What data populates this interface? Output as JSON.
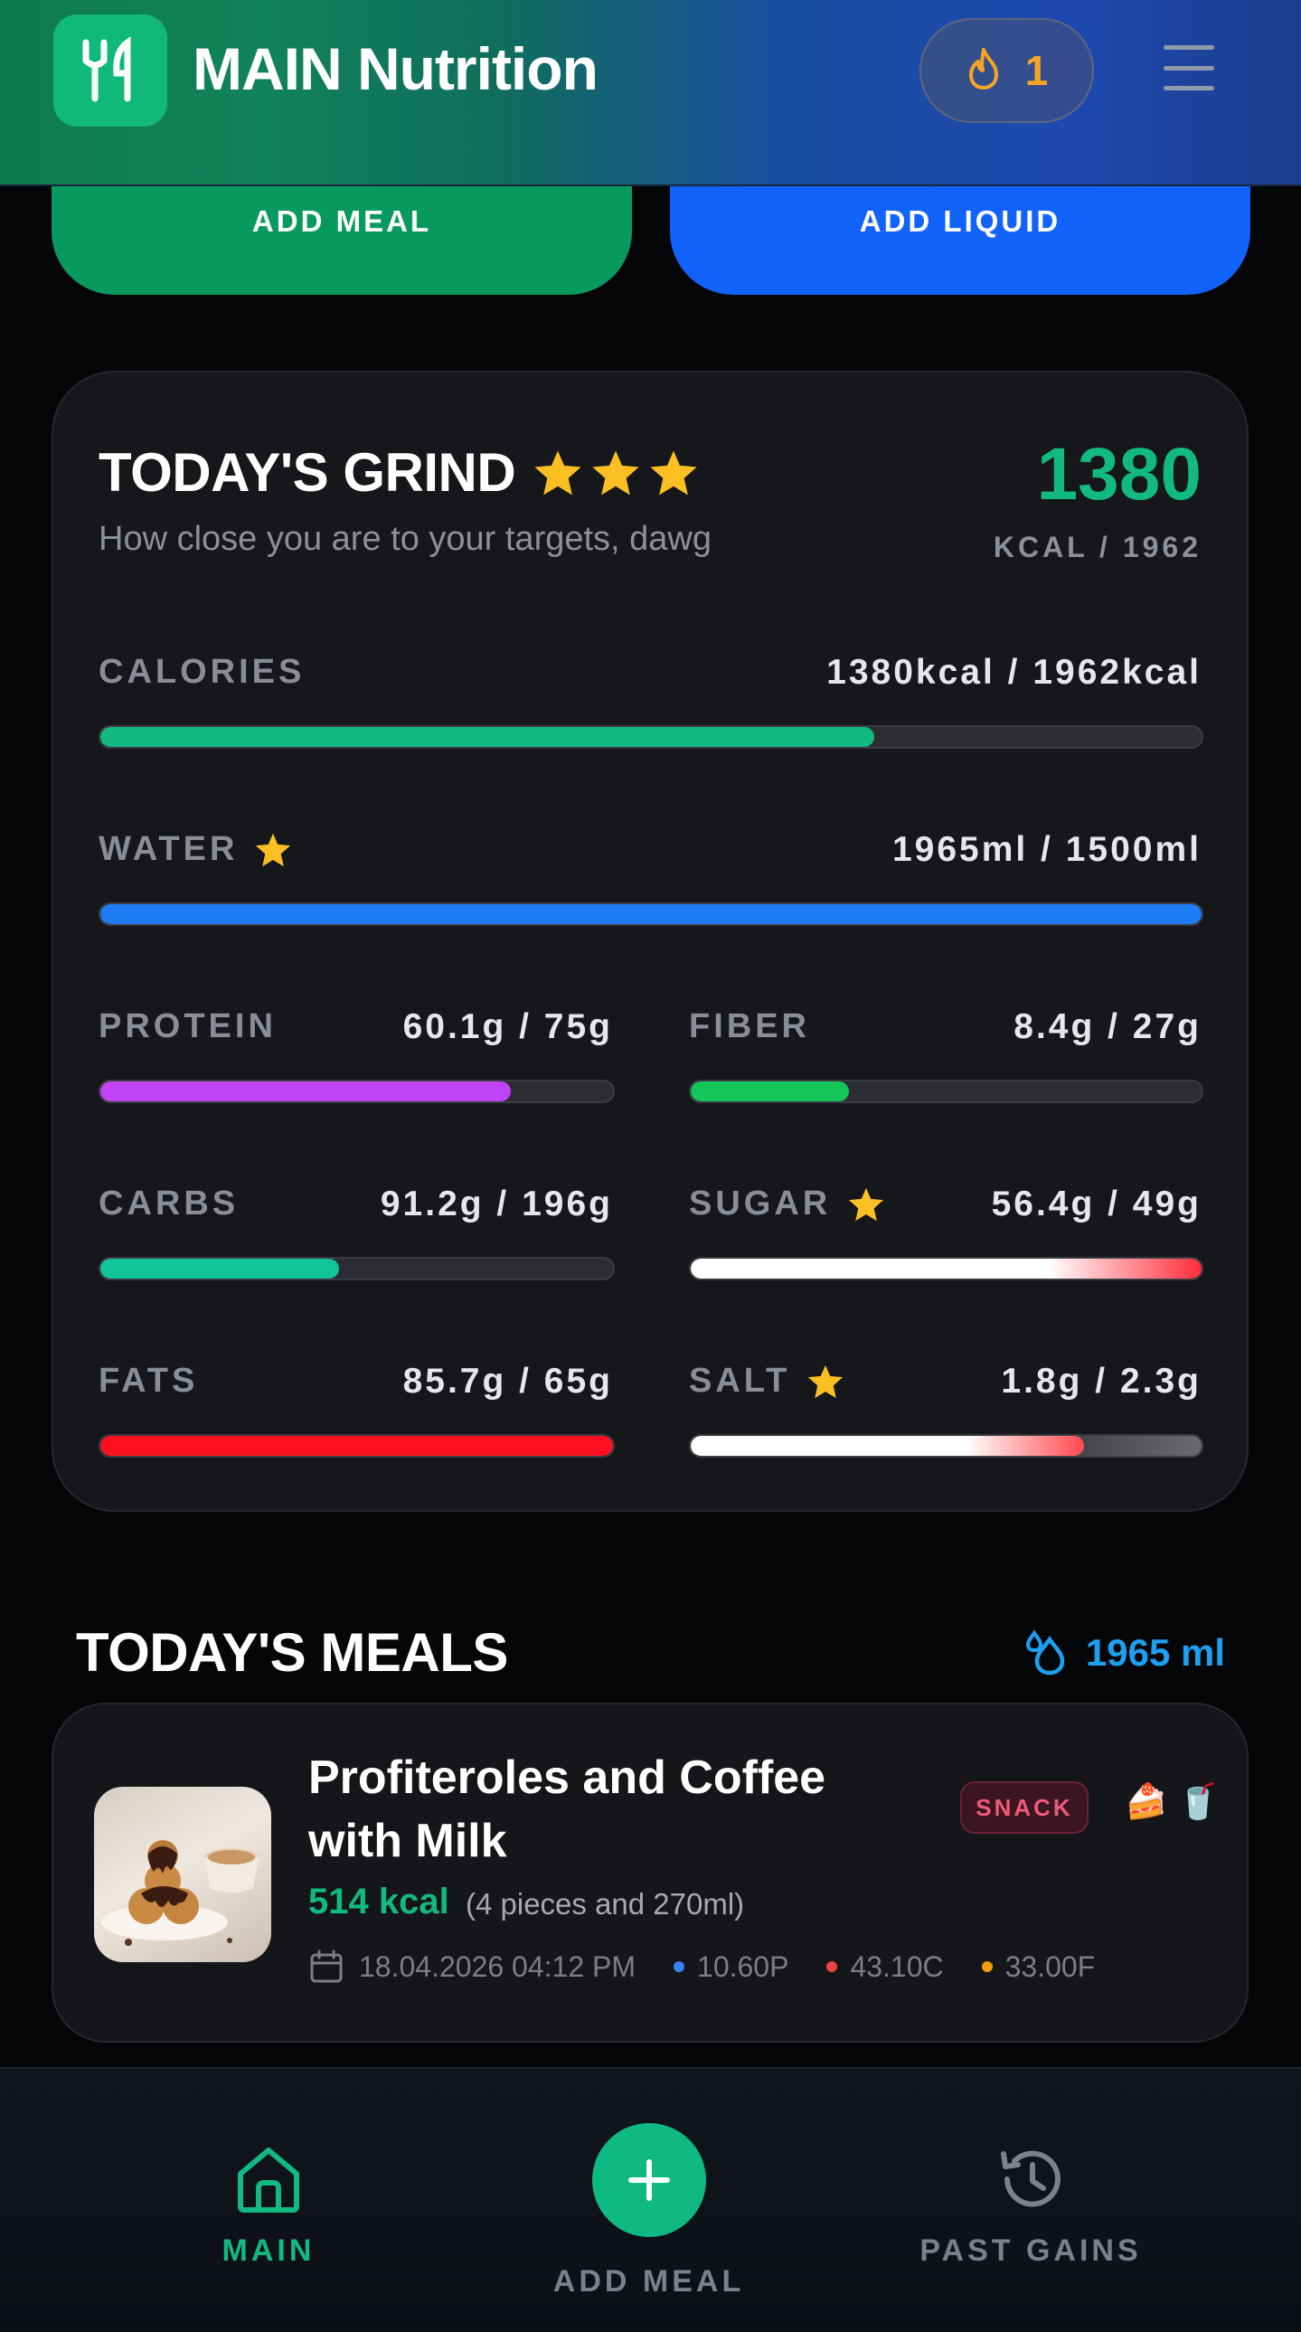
{
  "header": {
    "app_title": "MAIN Nutrition",
    "streak_count": "1",
    "logo_icon": "fork-knife-icon",
    "streak_icon": "flame-icon",
    "menu_icon": "hamburger-menu-icon"
  },
  "actions": {
    "add_meal_label": "ADD MEAL",
    "add_liquid_label": "ADD LIQUID"
  },
  "grind": {
    "title": "TODAY'S GRIND",
    "stars": 3,
    "subtitle": "How close you are to your targets, dawg",
    "kcal_value": "1380",
    "kcal_target": "KCAL / 1962",
    "metrics": {
      "calories": {
        "label": "CALORIES",
        "value": "1380kcal / 1962kcal",
        "progress": 0.703,
        "color": "#12b981"
      },
      "water": {
        "label": "WATER",
        "value": "1965ml / 1500ml",
        "progress": 1.0,
        "color": "#1e7cf5",
        "star": true
      },
      "protein": {
        "label": "PROTEIN",
        "value": "60.1g / 75g",
        "progress": 0.8,
        "color": "#c043f5"
      },
      "fiber": {
        "label": "FIBER",
        "value": "8.4g / 27g",
        "progress": 0.31,
        "color": "#14c559"
      },
      "carbs": {
        "label": "CARBS",
        "value": "91.2g / 196g",
        "progress": 0.465,
        "color": "#12c49a"
      },
      "sugar": {
        "label": "SUGAR",
        "value": "56.4g / 49g",
        "progress": 1.0,
        "color": "#ff2d3a",
        "star": true
      },
      "fats": {
        "label": "FATS",
        "value": "85.7g / 65g",
        "progress": 1.0,
        "color": "#ff1020"
      },
      "salt": {
        "label": "SALT",
        "value": "1.8g / 2.3g",
        "progress": 0.77,
        "color": "#ff4a50",
        "star": true
      }
    }
  },
  "meals": {
    "title": "TODAY'S MEALS",
    "water_total": "1965 ml",
    "items": [
      {
        "name": "Profiteroles and Coffee with Milk",
        "badge": "SNACK",
        "emojis": "🍰 🥤",
        "kcal": "514 kcal",
        "portion": "(4 pieces and 270ml)",
        "datetime": "18.04.2026 04:12 PM",
        "protein": "10.60P",
        "carbs": "43.10C",
        "fat": "33.00F"
      }
    ]
  },
  "nav": {
    "main_label": "MAIN",
    "add_meal_label": "ADD MEAL",
    "past_label": "PAST GAINS"
  },
  "colors": {
    "accent_green": "#12b981",
    "accent_blue": "#1263fb",
    "star_gold": "#fbbf24",
    "macro_protein_dot": "#3b82f6",
    "macro_carbs_dot": "#ef4444",
    "macro_fat_dot": "#f59e0b"
  }
}
